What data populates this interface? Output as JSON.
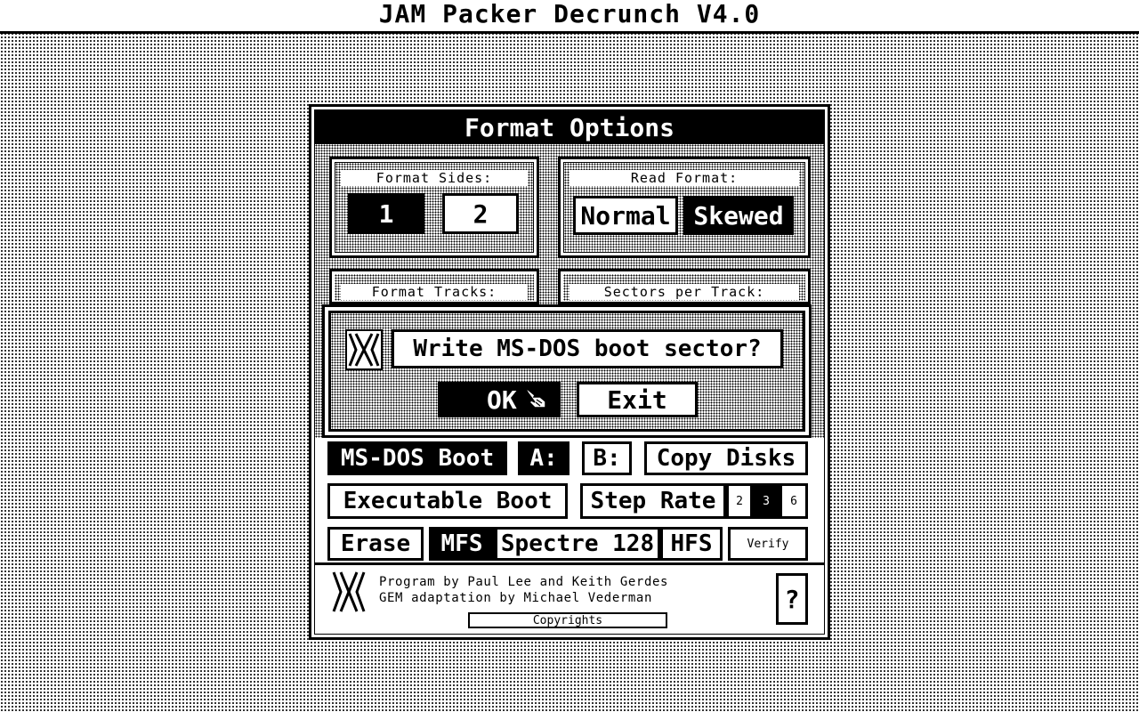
{
  "window": {
    "title": "JAM Packer Decrunch V4.0"
  },
  "dialog": {
    "title": "Format Options",
    "format_sides": {
      "label": "Format Sides:",
      "options": [
        "1",
        "2"
      ],
      "selected": "1"
    },
    "read_format": {
      "label": "Read Format:",
      "options": [
        "Normal",
        "Skewed"
      ],
      "selected": "Skewed"
    },
    "format_tracks": {
      "label": "Format Tracks:"
    },
    "sectors_per_track": {
      "label": "Sectors per Track:"
    },
    "ms_dos_boot": "MS-DOS Boot",
    "drive_a": "A:",
    "drive_b": "B:",
    "copy_disks": "Copy Disks",
    "executable_boot": "Executable Boot",
    "step_rate": {
      "label": "Step Rate",
      "options": [
        "2",
        "3",
        "6"
      ],
      "selected": "3"
    },
    "erase": "Erase",
    "mfs": "MFS",
    "spectre": "Spectre 128",
    "hfs": "HFS",
    "verify": "Verify",
    "credits_line1": "Program by Paul Lee and Keith Gerdes",
    "credits_line2": "GEM adaptation by Michael Vederman",
    "copyrights": "Copyrights",
    "help": "?"
  },
  "alert": {
    "message": "Write MS-DOS boot sector?",
    "ok": "OK",
    "exit": "Exit",
    "icon": "jam-logo-icon",
    "cursor": "pointing-hand-cursor-icon"
  },
  "colors": {
    "foreground": "#000000",
    "background": "#ffffff"
  }
}
